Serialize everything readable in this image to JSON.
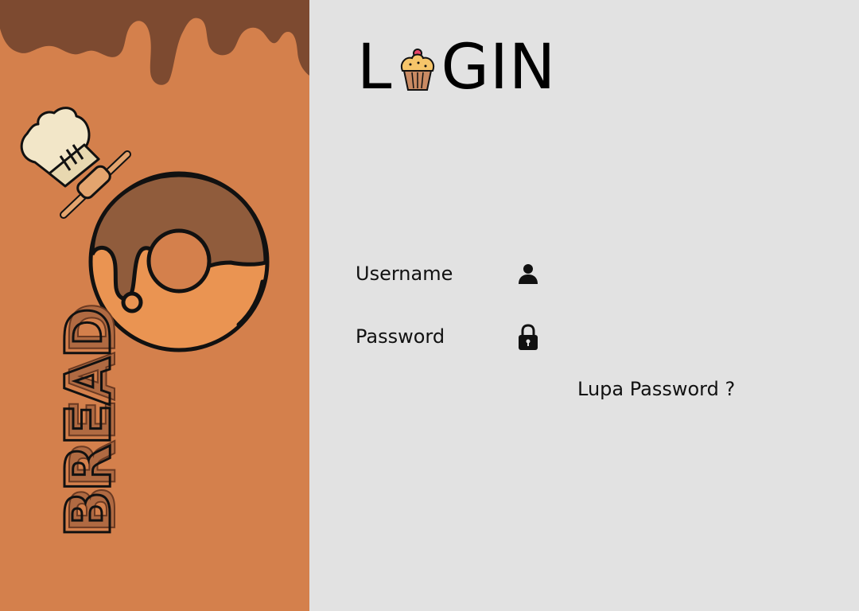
{
  "brand": {
    "name": "BREAD"
  },
  "login": {
    "title_first": "L",
    "title_rest": "GIN",
    "title_icon": "cupcake-icon"
  },
  "form": {
    "username_label": "Username",
    "username_icon": "user-icon",
    "username_value": "",
    "password_label": "Password",
    "password_icon": "lock-icon",
    "password_value": "",
    "forgot_label": "Lupa Password ?"
  },
  "colors": {
    "panel_orange": "#d4804c",
    "drip_brown": "#7d4a30",
    "background_gray": "#e2e2e2",
    "donut_frosting": "#905c3c",
    "donut_dough": "#ea9452"
  },
  "decorations": [
    "chocolate-drip",
    "chef-hat-icon",
    "rolling-pin-icon",
    "donut-icon"
  ]
}
